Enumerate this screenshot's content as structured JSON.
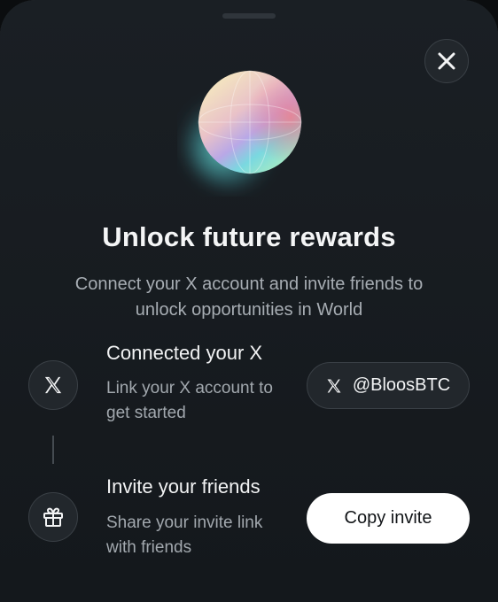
{
  "modal": {
    "title": "Unlock future rewards",
    "description": "Connect your X account and invite friends to unlock opportunities in World",
    "close_icon": "close-icon"
  },
  "steps": [
    {
      "icon": "x-logo-icon",
      "title": "Connected your X",
      "description": "Link your X account to get started",
      "action": {
        "icon": "x-logo-icon",
        "label": "@BloosBTC"
      }
    },
    {
      "icon": "gift-icon",
      "title": "Invite your friends",
      "description": "Share your invite link with friends",
      "action": {
        "label": "Copy invite"
      }
    }
  ],
  "colors": {
    "background": "#15191d",
    "surface": "#22272c",
    "primary_text": "#f4f5f6",
    "secondary_text": "#a7adb3",
    "button_light": "#ffffff"
  }
}
